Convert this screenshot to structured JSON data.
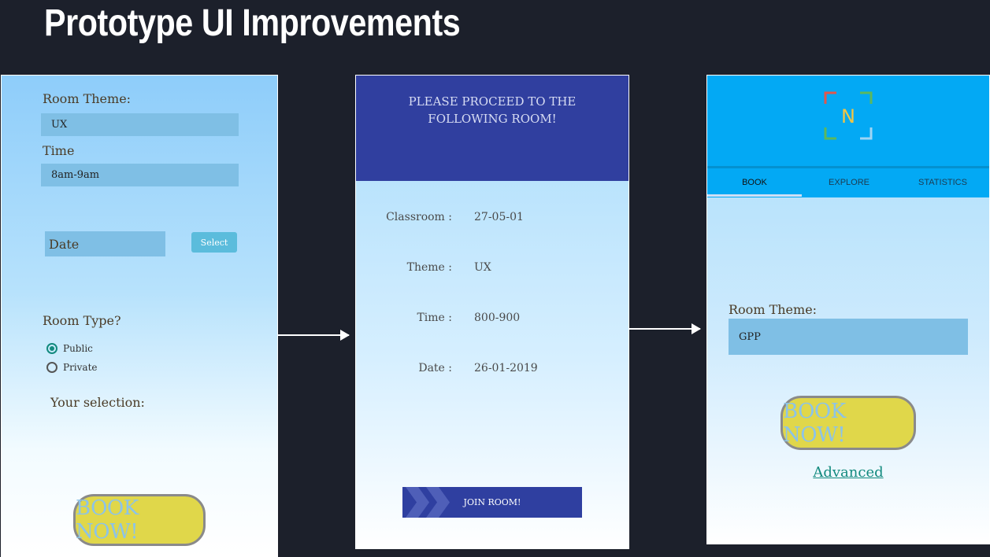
{
  "slide": {
    "title": "Prototype UI Improvements"
  },
  "screen1": {
    "room_theme_label": "Room Theme:",
    "room_theme_value": "UX",
    "time_label": "Time",
    "time_value": "8am-9am",
    "date_placeholder": "Date",
    "select_label": "Select",
    "room_type_label": "Room Type?",
    "options": [
      {
        "label": "Public",
        "selected": true
      },
      {
        "label": "Private",
        "selected": false
      }
    ],
    "selection_label": "Your selection:",
    "book_label": "BOOK NOW!"
  },
  "screen2": {
    "heading_line1": "PLEASE PROCEED TO THE",
    "heading_line2": "FOLLOWING ROOM!",
    "details": [
      {
        "key": "Classroom :",
        "value": "27-05-01"
      },
      {
        "key": "Theme :",
        "value": "UX"
      },
      {
        "key": "Time :",
        "value": "800-900"
      },
      {
        "key": "Date :",
        "value": "26-01-2019"
      }
    ],
    "join_label": "JOIN ROOM!"
  },
  "screen3": {
    "logo_letter": "N",
    "tabs": [
      {
        "label": "BOOK",
        "active": true
      },
      {
        "label": "EXPLORE",
        "active": false
      },
      {
        "label": "STATISTICS",
        "active": false
      }
    ],
    "room_theme_label": "Room Theme:",
    "room_theme_value": "GPP",
    "book_label": "BOOK NOW!",
    "advanced_label": "Advanced"
  },
  "colors": {
    "background": "#1c202b",
    "header_indigo": "#303f9f",
    "app_bar_blue": "#03a9f4",
    "book_button_yellow": "#e0d74a",
    "teal_accent": "#138a7e"
  }
}
